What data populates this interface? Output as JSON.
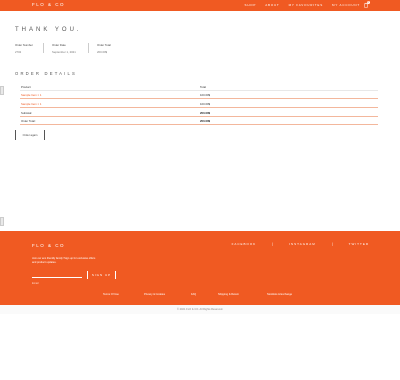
{
  "header": {
    "logo": "FLO & CO",
    "nav": [
      "Shop",
      "About",
      "My Favourites",
      "My Account"
    ],
    "cart_count": "0"
  },
  "confirmation": {
    "title": "THANK YOU.",
    "order_number_label": "Order Number",
    "order_number": "2702",
    "order_date_label": "Order Date",
    "order_date": "September 1, 2021",
    "order_total_label": "Order Total",
    "order_total": "200.00$"
  },
  "details": {
    "title": "ORDER DETAILS",
    "columns": [
      "Product",
      "Total"
    ],
    "items": [
      {
        "product": "Sample Item × 1",
        "total": "100.00$"
      },
      {
        "product": "Sample Item × 1",
        "total": "100.00$"
      }
    ],
    "subtotal_label": "Subtotal:",
    "subtotal": "200.00$",
    "total_label": "Order Total:",
    "total": "200.00$",
    "order_again": "Order again"
  },
  "footer": {
    "logo": "FLO & CO",
    "social": [
      "Facebook",
      "Instagram",
      "Twitter"
    ],
    "newsletter_text": "Join our eco friendly family! Sign up for exclusive offers and product updates.",
    "email_placeholder": "Email",
    "signup_label": "SIGN UP",
    "links": [
      "Terms Of Use",
      "Privacy & Cookies",
      "FAQ",
      "Shipping & Return",
      "Stockists & Exchange"
    ],
    "copyright": "© 2021 FLO & CO. All Rights Reserved."
  },
  "colors": {
    "brand": "#f05a22",
    "accent_line": "#f3b79c"
  },
  "icons": {
    "cart": "shopping-bag-icon"
  }
}
